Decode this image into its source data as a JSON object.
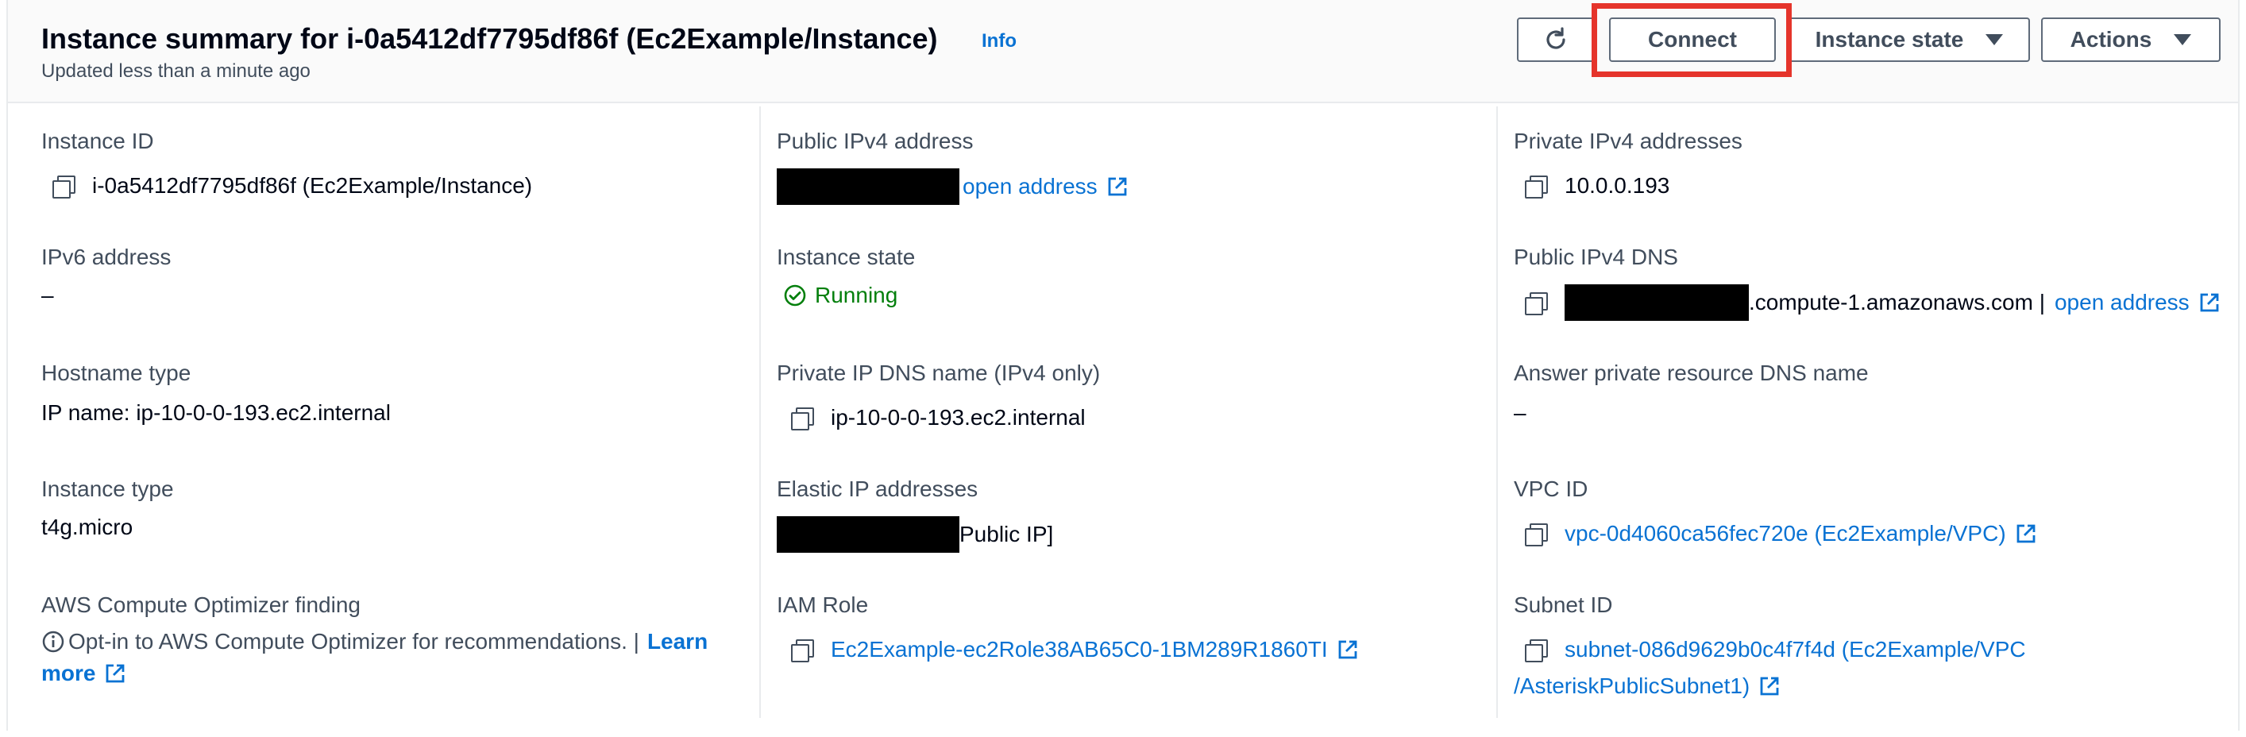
{
  "header": {
    "title": "Instance summary for i-0a5412df7795df86f (Ec2Example/Instance)",
    "info_label": "Info",
    "subtitle": "Updated less than a minute ago",
    "refresh_icon": "refresh-icon",
    "connect_label": "Connect",
    "instance_state_label": "Instance state",
    "actions_label": "Actions"
  },
  "colors": {
    "link": "#0972d3",
    "running": "#037f0c",
    "highlight": "#e5342b"
  },
  "col1": {
    "instance_id": {
      "label": "Instance ID",
      "value": "i-0a5412df7795df86f (Ec2Example/Instance)"
    },
    "ipv6": {
      "label": "IPv6 address",
      "value": "–"
    },
    "hostname_type": {
      "label": "Hostname type",
      "value": "IP name: ip-10-0-0-193.ec2.internal"
    },
    "instance_type": {
      "label": "Instance type",
      "value": "t4g.micro"
    },
    "optimizer": {
      "label": "AWS Compute Optimizer finding",
      "text": "Opt-in to AWS Compute Optimizer for recommendations. |",
      "link_learn": "Learn",
      "link_more": "more"
    }
  },
  "col2": {
    "public_ipv4": {
      "label": "Public IPv4 address",
      "link": "open address"
    },
    "instance_state": {
      "label": "Instance state",
      "value": "Running"
    },
    "private_dns": {
      "label": "Private IP DNS name (IPv4 only)",
      "value": "ip-10-0-0-193.ec2.internal"
    },
    "elastic_ip": {
      "label": "Elastic IP addresses",
      "value_suffix": "Public IP]"
    },
    "iam_role": {
      "label": "IAM Role",
      "value": "Ec2Example-ec2Role38AB65C0-1BM289R1860TI"
    }
  },
  "col3": {
    "private_ipv4": {
      "label": "Private IPv4 addresses",
      "value": "10.0.0.193"
    },
    "public_dns": {
      "label": "Public IPv4 DNS",
      "value_suffix": ".compute-1.amazonaws.com |",
      "link": "open address"
    },
    "answer_dns": {
      "label": "Answer private resource DNS name",
      "value": "–"
    },
    "vpc_id": {
      "label": "VPC ID",
      "value": "vpc-0d4060ca56fec720e (Ec2Example/VPC)"
    },
    "subnet_id": {
      "label": "Subnet ID",
      "value_line1": "subnet-086d9629b0c4f7f4d (Ec2Example/VPC",
      "value_line2": "/AsteriskPublicSubnet1)"
    }
  }
}
